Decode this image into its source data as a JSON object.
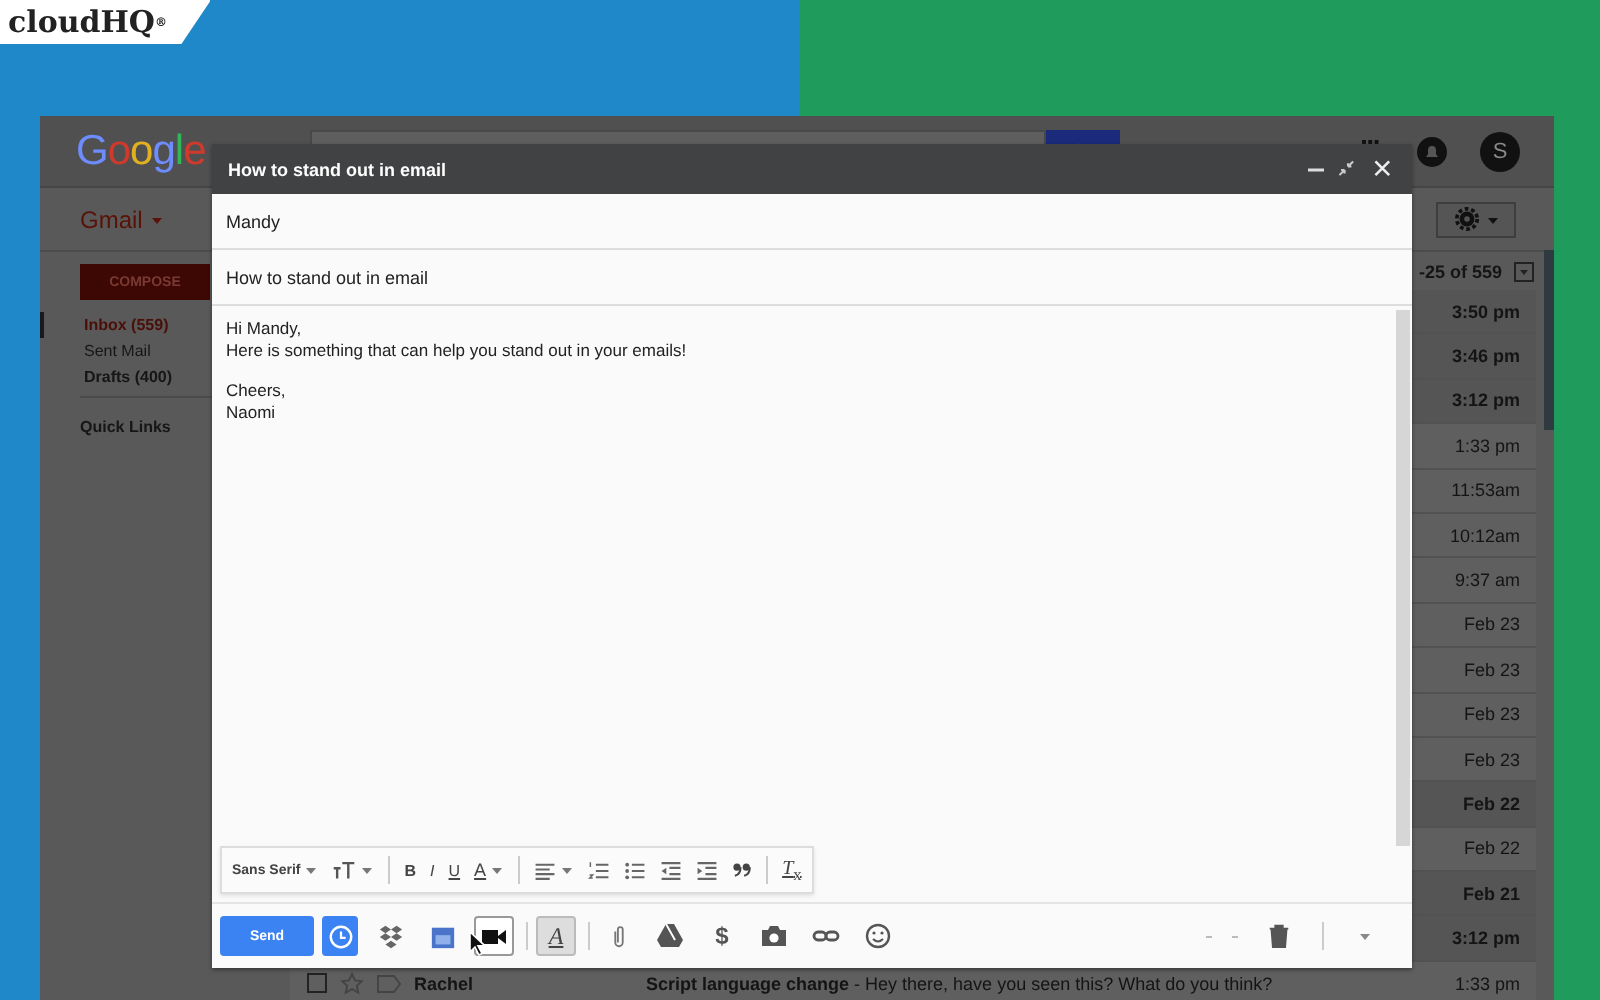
{
  "brand": {
    "logo": "cloudHQ$^{®}$"
  },
  "gmail": {
    "logo": "Google",
    "app_menu": "Gmail",
    "avatar": "S",
    "nav": {
      "compose": "COMPOSE",
      "items": [
        {
          "label": "Inbox (559)",
          "selected": true,
          "bold": true
        },
        {
          "label": "Sent Mail",
          "selected": false,
          "bold": false
        },
        {
          "label": "Drafts (400)",
          "selected": false,
          "bold": true
        }
      ],
      "quick_links": "Quick Links"
    },
    "pagination": "-25 of 559",
    "rows": [
      {
        "time": "3:50 pm",
        "unread": true
      },
      {
        "time": "3:46 pm",
        "unread": true
      },
      {
        "time": "3:12 pm",
        "unread": true
      },
      {
        "time": "1:33 pm",
        "unread": false
      },
      {
        "time": "11:53am",
        "unread": false
      },
      {
        "time": "10:12am",
        "unread": false
      },
      {
        "time": "9:37 am",
        "unread": false
      },
      {
        "time": "Feb 23",
        "unread": false
      },
      {
        "time": "Feb 23",
        "unread": false
      },
      {
        "time": "Feb 23",
        "unread": false
      },
      {
        "time": "Feb 23",
        "unread": false
      },
      {
        "time": "Feb 22",
        "unread": true
      },
      {
        "time": "Feb 22",
        "unread": false
      },
      {
        "time": "Feb 21",
        "unread": true
      },
      {
        "time": "3:12 pm",
        "unread": true
      },
      {
        "time": "1:33 pm",
        "unread": false,
        "sender": "Rachel",
        "subject": "Script language change",
        "snippet": " - Hey there, have you seen this? What do you think?"
      }
    ]
  },
  "compose": {
    "title": "How to stand out in email",
    "to": "Mandy",
    "subject": "How to stand out in email",
    "body": [
      [
        "Hi Mandy,",
        "Here is something that can help you stand out in your emails!"
      ],
      [
        "Cheers,",
        "Naomi"
      ]
    ],
    "format_bar": [
      {
        "kind": "font",
        "label": "Sans Serif"
      },
      {
        "kind": "size"
      },
      {
        "kind": "sep"
      },
      {
        "kind": "letter",
        "label": "B"
      },
      {
        "kind": "letter",
        "label": "I"
      },
      {
        "kind": "letter",
        "label": "U"
      },
      {
        "kind": "color",
        "label": "A"
      },
      {
        "kind": "sep"
      },
      {
        "kind": "align"
      },
      {
        "kind": "numbered"
      },
      {
        "kind": "bulleted"
      },
      {
        "kind": "outdent"
      },
      {
        "kind": "indent"
      },
      {
        "kind": "quote"
      },
      {
        "kind": "sep"
      },
      {
        "kind": "clear",
        "label": "*T*$_{x}$"
      }
    ],
    "send": "Send",
    "actions": [
      {
        "kind": "schedule",
        "selected": false
      },
      {
        "kind": "dropbox",
        "selected": false
      },
      {
        "kind": "calendar",
        "selected": false
      },
      {
        "kind": "video",
        "selected": true
      },
      {
        "kind": "sep"
      },
      {
        "kind": "format",
        "label": "A",
        "selected": true
      },
      {
        "kind": "sep"
      },
      {
        "kind": "attach",
        "selected": false
      },
      {
        "kind": "drive",
        "selected": false
      },
      {
        "kind": "money",
        "label": "$",
        "selected": false
      },
      {
        "kind": "photo",
        "selected": false
      },
      {
        "kind": "link",
        "selected": false
      },
      {
        "kind": "emoji",
        "selected": false
      }
    ]
  }
}
